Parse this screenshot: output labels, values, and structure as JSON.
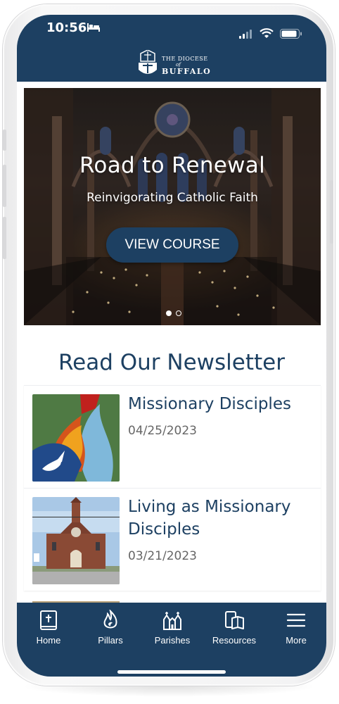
{
  "status_bar": {
    "time": "10:56"
  },
  "header": {
    "logo_line1": "THE DIOCESE",
    "logo_line2": "of",
    "logo_line3": "BUFFALO"
  },
  "hero": {
    "title": "Road to Renewal",
    "subtitle": "Reinvigorating Catholic Faith",
    "button_label": "VIEW COURSE",
    "slide_count": 2,
    "active_slide": 1
  },
  "newsletter": {
    "section_title": "Read Our Newsletter",
    "items": [
      {
        "title": "Missionary Disciples",
        "date": "04/25/2023"
      },
      {
        "title": "Living as Missionary Disciples",
        "date": "03/21/2023"
      }
    ]
  },
  "tabbar": {
    "items": [
      {
        "label": "Home",
        "icon": "bible-icon"
      },
      {
        "label": "Pillars",
        "icon": "flame-icon"
      },
      {
        "label": "Parishes",
        "icon": "church-icon"
      },
      {
        "label": "Resources",
        "icon": "book-icon"
      },
      {
        "label": "More",
        "icon": "menu-icon"
      }
    ]
  },
  "colors": {
    "brand_navy": "#1d4062",
    "text_gray": "#666666",
    "white": "#ffffff"
  }
}
